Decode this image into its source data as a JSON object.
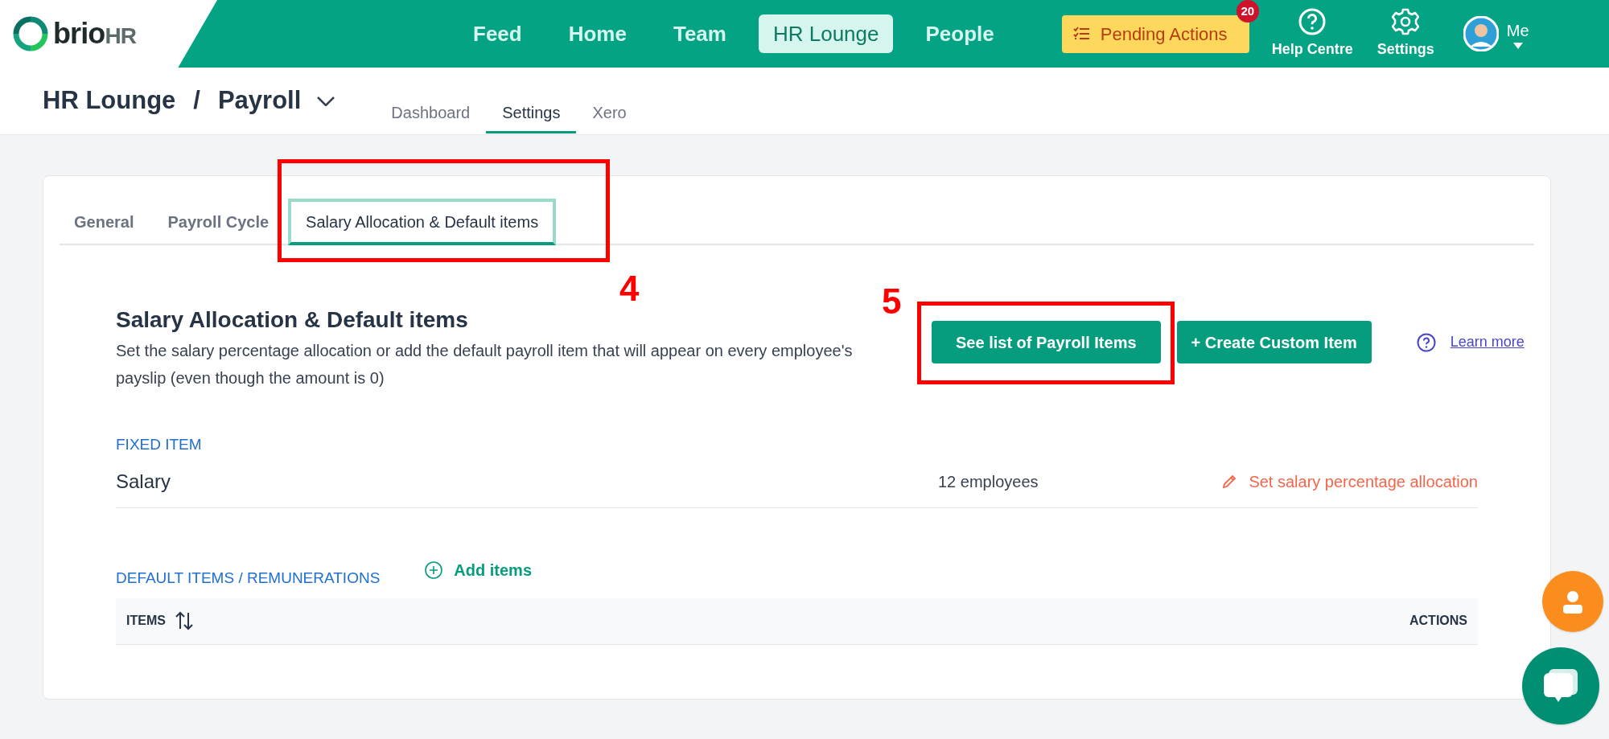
{
  "brand": {
    "name_part_1": "brio",
    "name_part_2": "HR"
  },
  "nav": [
    {
      "label": "Feed",
      "selected": false
    },
    {
      "label": "Home",
      "selected": false
    },
    {
      "label": "Team",
      "selected": false
    },
    {
      "label": "HR Lounge",
      "selected": true
    },
    {
      "label": "People",
      "selected": false
    }
  ],
  "pending_actions": {
    "label": "Pending Actions",
    "count": "20"
  },
  "header_links": [
    {
      "kind": "help",
      "label": "Help Centre"
    },
    {
      "kind": "settings",
      "label": "Settings"
    }
  ],
  "user_menu": {
    "label": "Me"
  },
  "breadcrumb": [
    "HR Lounge",
    "/",
    "Payroll"
  ],
  "page_tabs": [
    {
      "label": "Dashboard",
      "selected": false
    },
    {
      "label": "Settings",
      "selected": true
    },
    {
      "label": "Xero",
      "selected": false
    }
  ],
  "settings_tabs": [
    {
      "label": "General",
      "selected": false
    },
    {
      "label": "Payroll Cycle",
      "selected": false
    },
    {
      "label": "Salary Allocation & Default items",
      "selected": true
    }
  ],
  "section": {
    "title": "Salary Allocation & Default items",
    "description": "Set the salary percentage allocation or add the default payroll item that will appear on every employee's payslip (even though the amount is 0)"
  },
  "buttons": [
    "See list of Payroll Items",
    "+ Create Custom Item"
  ],
  "learn_more": "Learn more",
  "fixed_item": {
    "heading": "FIXED ITEM",
    "name": "Salary",
    "employees": "12 employees",
    "action": "Set salary percentage allocation"
  },
  "default_items": {
    "heading": "DEFAULT ITEMS / REMUNERATIONS",
    "add": "Add items",
    "columns": [
      "ITEMS",
      "ACTIONS"
    ]
  },
  "annotations": [
    "4",
    "5"
  ]
}
